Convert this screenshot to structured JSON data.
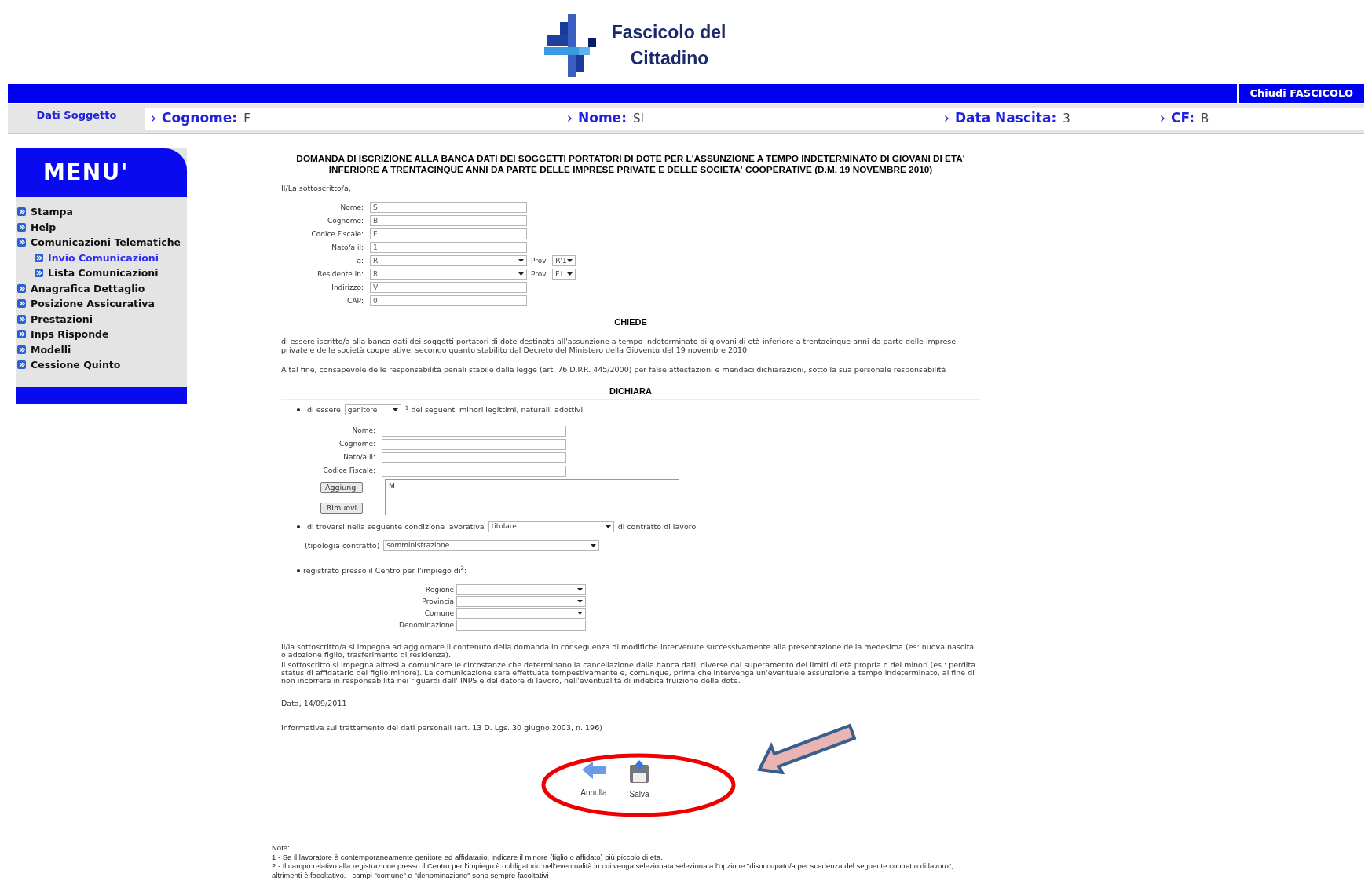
{
  "header": {
    "logo_lines": [
      "Fascicolo del",
      "Cittadino"
    ],
    "close_button": "Chiudi FASCICOLO"
  },
  "subject_bar": {
    "title": "Dati Soggetto",
    "fields": [
      {
        "label": "Cognome:",
        "value": "F"
      },
      {
        "label": "Nome:",
        "value": "SI"
      },
      {
        "label": "Data Nascita:",
        "value": "3"
      },
      {
        "label": "CF:",
        "value": "B"
      }
    ]
  },
  "menu": {
    "title": "MENU'",
    "items": [
      {
        "label": "Stampa",
        "selected": false
      },
      {
        "label": "Help",
        "selected": false
      },
      {
        "label": "Comunicazioni Telematiche",
        "selected": false,
        "children": [
          {
            "label": "Invio Comunicazioni",
            "selected": true
          },
          {
            "label": "Lista Comunicazioni",
            "selected": false
          }
        ]
      },
      {
        "label": "Anagrafica Dettaglio",
        "selected": false
      },
      {
        "label": "Posizione Assicurativa",
        "selected": false
      },
      {
        "label": "Prestazioni",
        "selected": false
      },
      {
        "label": "Inps Risponde",
        "selected": false
      },
      {
        "label": "Modelli",
        "selected": false
      },
      {
        "label": "Cessione Quinto",
        "selected": false
      }
    ]
  },
  "form": {
    "title": "DOMANDA DI ISCRIZIONE ALLA BANCA DATI DEI SOGGETTI PORTATORI DI DOTE PER L'ASSUNZIONE A TEMPO INDETERMINATO DI GIOVANI DI ETA' INFERIORE A TRENTACINQUE ANNI DA PARTE DELLE IMPRESE PRIVATE E DELLE SOCIETA' COOPERATIVE (D.M. 19 NOVEMBRE 2010)",
    "intro": "Il/La sottoscritto/a,",
    "applicant": [
      {
        "label": "Nome:",
        "kind": "text",
        "value": "S"
      },
      {
        "label": "Cognome:",
        "kind": "text",
        "value": "B"
      },
      {
        "label": "Codice Fiscale:",
        "kind": "text",
        "value": "E"
      },
      {
        "label": "Nato/a il:",
        "kind": "text",
        "value": "1"
      },
      {
        "label": "a:",
        "kind": "select",
        "value": "R",
        "prov": {
          "label": "Prov:",
          "value": "R'1"
        }
      },
      {
        "label": "Residente in:",
        "kind": "select",
        "value": "R",
        "prov": {
          "label": "Prov:",
          "value": "F.I"
        }
      },
      {
        "label": "Indirizzo:",
        "kind": "text",
        "value": "V"
      },
      {
        "label": "CAP:",
        "kind": "text",
        "value": "0"
      }
    ],
    "chiede": {
      "heading": "CHIEDE",
      "paragraphs": [
        "di essere iscritto/a alla banca dati dei soggetti portatori di dote destinata all'assunzione a tempo indeterminato di giovani di età inferiore a trentacinque anni da parte delle imprese private e delle società cooperative, secondo quanto stabilito dal Decreto del Ministero della Gioventù del 19 novembre 2010.",
        "A tal fine, consapevole delle responsabilità penali stabile dalla legge (art. 76 D.P.R. 445/2000) per false attestazioni e mendaci dichiarazioni, sotto la sua personale responsabilità"
      ]
    },
    "dichiara": {
      "heading": "DICHIARA",
      "role": {
        "prefix": "di essere",
        "select": "genitore",
        "suffix": "$^{1}$ dei seguenti minori legittimi, naturali, adottivi"
      },
      "minor_fields": [
        "Nome:",
        "Cognome:",
        "Nato/a il:",
        "Codice Fiscale:"
      ],
      "add_button": "Aggiungi",
      "remove_button": "Rimuovi",
      "minors_list": [
        "M"
      ],
      "work": {
        "prefix": "di trovarsi nella seguente condizione lavorativa",
        "select": "titolare",
        "suffix": "di contratto di lavoro",
        "contract_label": "(tipologia contratto)",
        "contract_select": "somministrazione"
      },
      "office": {
        "text": "registrato presso il Centro per l'impiego di$^{2}$:",
        "fields": [
          {
            "label": "Regione",
            "kind": "select"
          },
          {
            "label": "Provincia",
            "kind": "select"
          },
          {
            "label": "Comune",
            "kind": "select"
          },
          {
            "label": "Denominazione",
            "kind": "text"
          }
        ]
      }
    },
    "commitments": [
      "Il/la sottoscritto/a si impegna ad aggiornare il contenuto della domanda in conseguenza di modifiche intervenute successivamente alla presentazione della medesima (es: nuova nascita o adozione figlio, trasferimento di residenza).",
      "Il sottoscritto si impegna altresì a comunicare le circostanze che determinano la cancellazione dalla banca dati, diverse dal superamento dei limiti di età propria o dei minori (es.: perdita status di affidatario del figlio minore). La comunicazione sarà effettuata tempestivamente e, comunque, prima che intervenga un'eventuale assunzione a tempo indeterminato, al fine di non incorrere in responsabilità nei riguardi dell' INPS e del datore di lavoro, nell'eventualità di indebita fruizione della dote."
    ],
    "date": "Data, 14/09/2011",
    "privacy": "Informativa sul trattamento dei dati personali (art. 13 D. Lgs. 30 giugno 2003, n. 196)",
    "actions": [
      {
        "label": "Annulla",
        "kind": "back"
      },
      {
        "label": "Salva",
        "kind": "save"
      }
    ]
  },
  "notes": {
    "title": "Note:",
    "lines": [
      "1 - Se il lavoratore è contemporaneamente genitore ed affidatario, indicare il minore (figlio o affidato) più piccolo di eta.",
      "2 - Il campo relativo alla registrazione presso il Centro per l'impiego è obbligatorio nell'eventualità in cui venga selezionata selezionata l'opzione \"disoccupato/a per scadenza del seguente contratto di lavoro\"; altrimenti è facoltativo. I campi \"comune\" e \"denominazione\" sono sempre facoltativi"
    ]
  }
}
